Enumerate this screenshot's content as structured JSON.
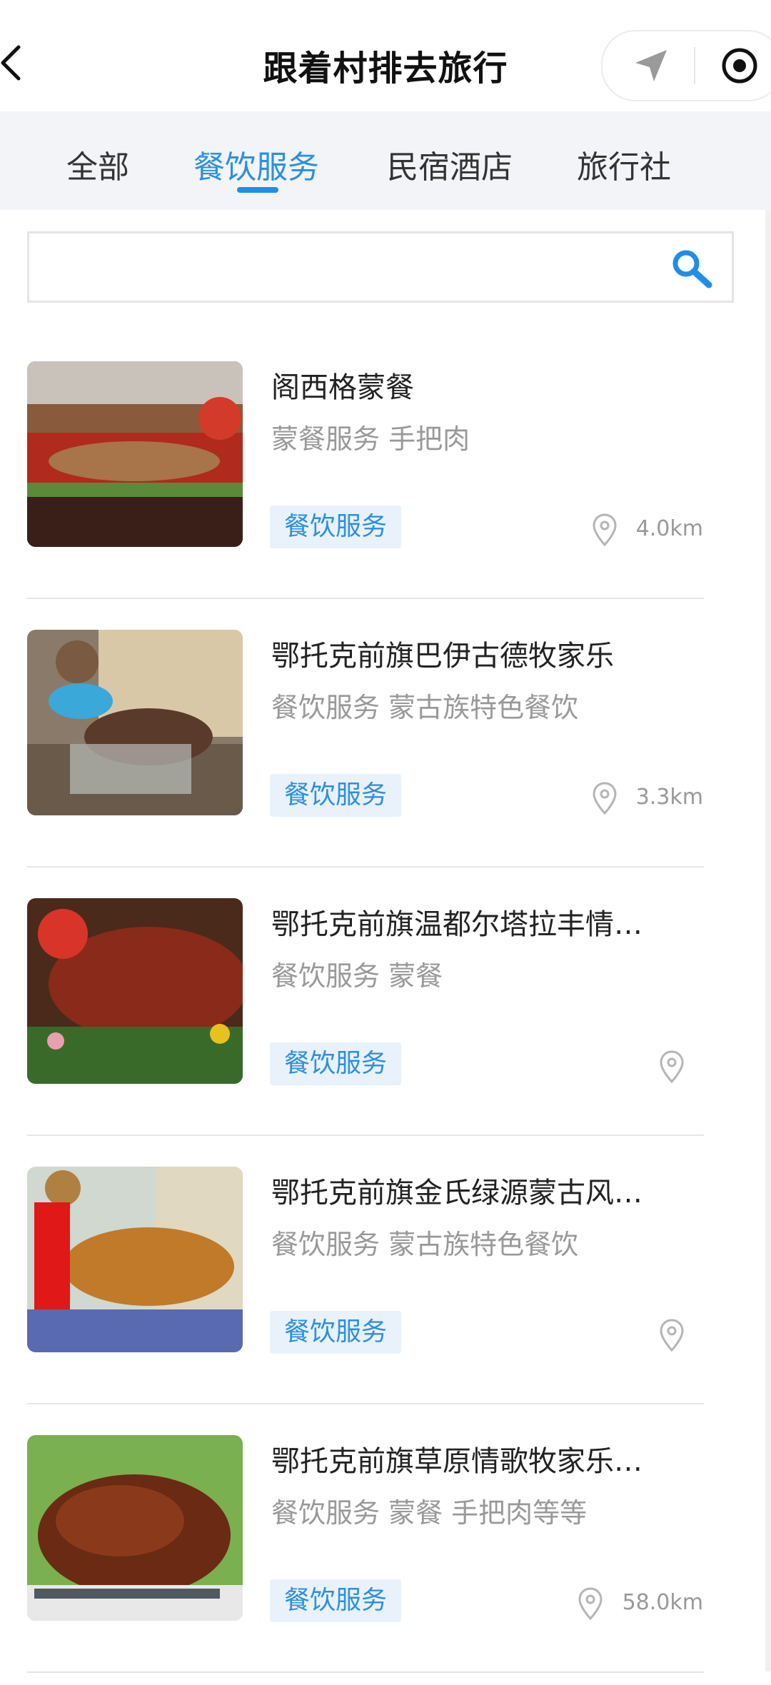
{
  "header": {
    "title": "跟着村排去旅行"
  },
  "tabs": [
    {
      "label": "全部",
      "active": false
    },
    {
      "label": "餐饮服务",
      "active": true
    },
    {
      "label": "民宿酒店",
      "active": false
    },
    {
      "label": "旅行社",
      "active": false
    }
  ],
  "search": {
    "placeholder": ""
  },
  "items": [
    {
      "title": "阁西格蒙餐",
      "subtitle": "蒙餐服务 手把肉",
      "tag": "餐饮服务",
      "distance": "4.0km"
    },
    {
      "title": "鄂托克前旗巴伊古德牧家乐",
      "subtitle": "餐饮服务 蒙古族特色餐饮",
      "tag": "餐饮服务",
      "distance": "3.3km"
    },
    {
      "title": "鄂托克前旗温都尔塔拉丰情…",
      "subtitle": "餐饮服务 蒙餐",
      "tag": "餐饮服务",
      "distance": ""
    },
    {
      "title": "鄂托克前旗金氏绿源蒙古风…",
      "subtitle": "餐饮服务 蒙古族特色餐饮",
      "tag": "餐饮服务",
      "distance": ""
    },
    {
      "title": "鄂托克前旗草原情歌牧家乐…",
      "subtitle": "餐饮服务 蒙餐 手把肉等等",
      "tag": "餐饮服务",
      "distance": "58.0km"
    }
  ],
  "colors": {
    "accent": "#2d8fe0",
    "tab_bar_bg": "#f2f4f7",
    "tag_bg": "#e9f2fb"
  },
  "icons": [
    "back-arrow-icon",
    "navigation-arrow-icon",
    "record-icon",
    "search-icon",
    "location-pin-icon"
  ]
}
